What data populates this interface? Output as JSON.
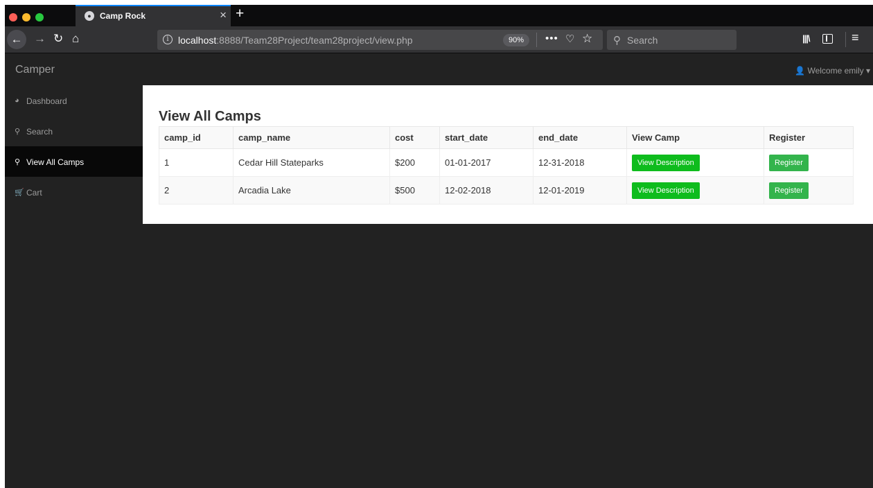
{
  "browser": {
    "tab": {
      "title": "Camp Rock",
      "favicon": "mammoth-favicon"
    },
    "url": {
      "host": "localhost",
      "path": ":8888/Team28Project/team28project/view.php"
    },
    "zoom": "90%",
    "search_placeholder": "Search"
  },
  "header": {
    "brand": "Camper",
    "welcome": "Welcome emily"
  },
  "sidebar": {
    "items": [
      {
        "label": "Dashboard",
        "icon": "tachometer-icon",
        "active": false
      },
      {
        "label": "Search",
        "icon": "search-icon",
        "active": false
      },
      {
        "label": "View All Camps",
        "icon": "search-icon",
        "active": true
      },
      {
        "label": "Cart",
        "icon": "cart-icon",
        "active": false
      }
    ]
  },
  "main": {
    "title": "View All Camps",
    "columns": [
      "camp_id",
      "camp_name",
      "cost",
      "start_date",
      "end_date",
      "View Camp",
      "Register"
    ],
    "rows": [
      {
        "camp_id": "1",
        "camp_name": "Cedar Hill Stateparks",
        "cost": "$200",
        "start_date": "01-01-2017",
        "end_date": "12-31-2018",
        "view_label": "View Description",
        "register_label": "Register"
      },
      {
        "camp_id": "2",
        "camp_name": "Arcadia Lake",
        "cost": "$500",
        "start_date": "12-02-2018",
        "end_date": "12-01-2019",
        "view_label": "View Description",
        "register_label": "Register"
      }
    ]
  },
  "colors": {
    "accent_tab": "#0a84ff",
    "view_button": "#0ebc1d",
    "register_button": "#33b44c",
    "nav_active_bg": "#080808",
    "page_bg": "#222222"
  }
}
